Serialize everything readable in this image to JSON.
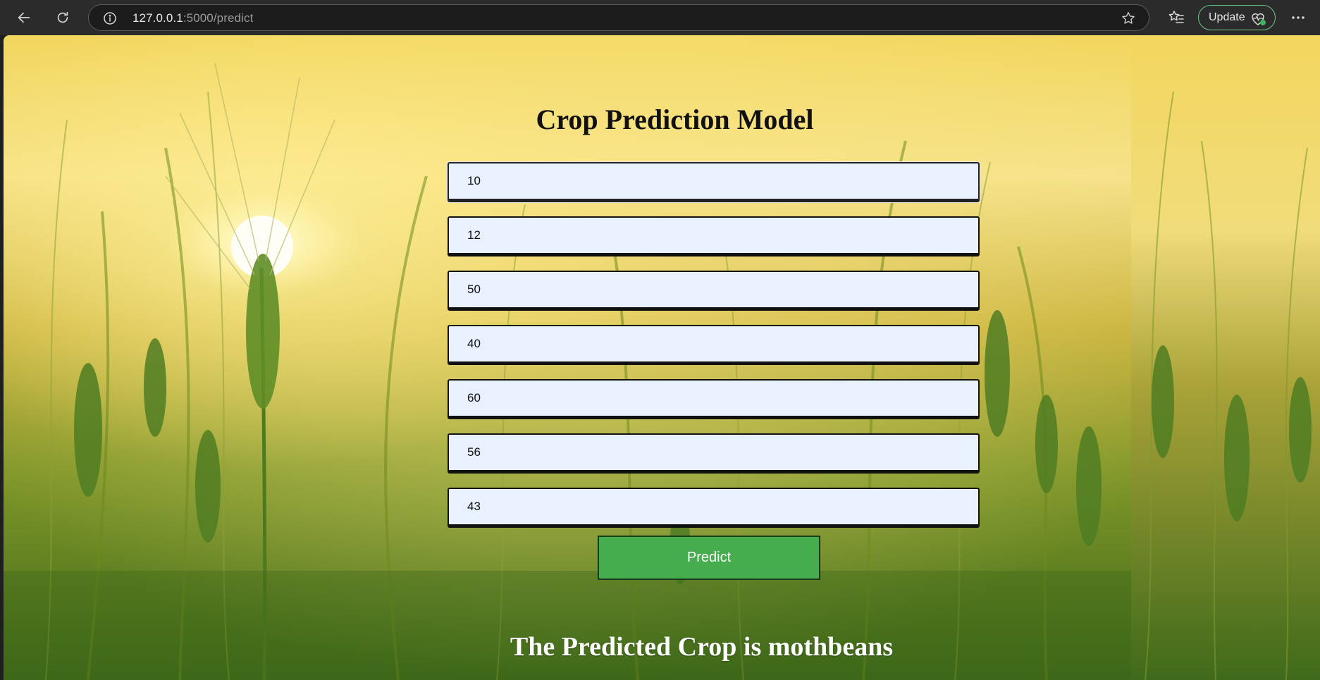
{
  "browser": {
    "url_host": "127.0.0.1",
    "url_rest": ":5000/predict",
    "update_label": "Update",
    "icons": {
      "back": "back-arrow-icon",
      "reload": "reload-icon",
      "info": "info-icon",
      "star": "star-icon",
      "favorites": "favorites-icon",
      "health": "heart-icon",
      "more": "more-icon"
    }
  },
  "page": {
    "title": "Crop Prediction Model",
    "fields": [
      "10",
      "12",
      "50",
      "40",
      "60",
      "56",
      "43"
    ],
    "predict_label": "Predict",
    "result": "The Predicted Crop is mothbeans"
  },
  "colors": {
    "field_bg": "#e9f0fe",
    "button_bg": "#46ad4f",
    "update_border": "#6fc98a"
  }
}
